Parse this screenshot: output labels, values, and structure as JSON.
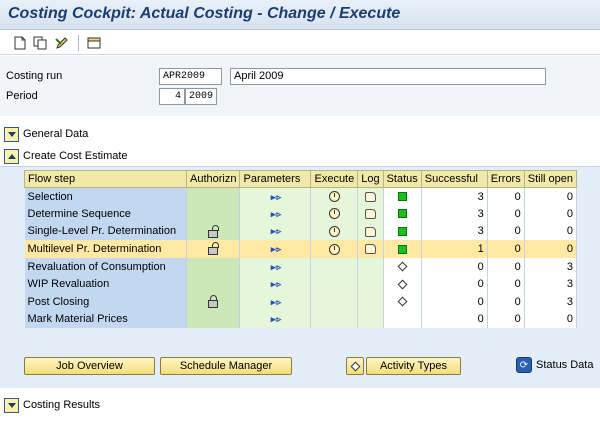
{
  "window": {
    "title": "Costing Cockpit: Actual Costing - Change / Execute"
  },
  "toolbar": {
    "icons": [
      "new-document-icon",
      "copy-icon",
      "edit-pencil-icon",
      "settings-icon"
    ]
  },
  "form": {
    "costing_run_label": "Costing run",
    "costing_run_value": "APR2009",
    "costing_run_desc": "April 2009",
    "period_label": "Period",
    "period_month": "4",
    "period_year": "2009"
  },
  "sections": {
    "general_data": "General Data",
    "create_cost_estimate": "Create Cost Estimate",
    "costing_results": "Costing Results"
  },
  "table": {
    "headers": [
      "Flow step",
      "Authorizn",
      "Parameters",
      "Execute",
      "Log",
      "Status",
      "Successful",
      "Errors",
      "Still open"
    ],
    "rows": [
      {
        "step": "Selection",
        "auth": "",
        "params": true,
        "execute": true,
        "log": true,
        "status": "green",
        "successful": "3",
        "errors": "0",
        "open": "0",
        "highlight": false
      },
      {
        "step": "Determine Sequence",
        "auth": "",
        "params": true,
        "execute": true,
        "log": true,
        "status": "green",
        "successful": "3",
        "errors": "0",
        "open": "0",
        "highlight": false
      },
      {
        "step": "Single-Level Pr. Determination",
        "auth": "open-lock",
        "params": true,
        "execute": true,
        "log": true,
        "status": "green",
        "successful": "3",
        "errors": "0",
        "open": "0",
        "highlight": false
      },
      {
        "step": "Multilevel Pr. Determination",
        "auth": "open-lock",
        "params": true,
        "execute": true,
        "log": true,
        "status": "green",
        "successful": "1",
        "errors": "0",
        "open": "0",
        "highlight": true
      },
      {
        "step": "Revaluation of Consumption",
        "auth": "",
        "params": true,
        "execute": false,
        "log": false,
        "status": "diamond",
        "successful": "0",
        "errors": "0",
        "open": "3",
        "highlight": false
      },
      {
        "step": "WIP Revaluation",
        "auth": "",
        "params": true,
        "execute": false,
        "log": false,
        "status": "diamond",
        "successful": "0",
        "errors": "0",
        "open": "3",
        "highlight": false
      },
      {
        "step": "Post Closing",
        "auth": "closed-lock",
        "params": true,
        "execute": false,
        "log": false,
        "status": "diamond",
        "successful": "0",
        "errors": "0",
        "open": "3",
        "highlight": false
      },
      {
        "step": "Mark Material Prices",
        "auth": "",
        "params": true,
        "execute": false,
        "log": false,
        "status": "",
        "successful": "0",
        "errors": "0",
        "open": "0",
        "highlight": false
      }
    ]
  },
  "buttons": {
    "job_overview": "Job Overview",
    "schedule_manager": "Schedule Manager",
    "activity_types": "Activity Types",
    "status_data": "Status Data"
  }
}
